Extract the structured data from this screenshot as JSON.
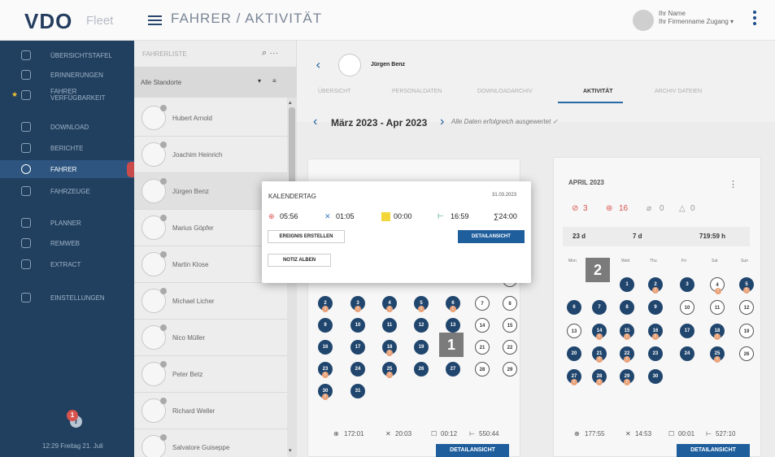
{
  "app": {
    "logo": "VDO",
    "logo_sub": "Fleet",
    "title": "FAHRER / AKTIVITÄT"
  },
  "user": {
    "name": "Ihr Name",
    "sub": "Ihr Firmenname Zugang"
  },
  "sidebar": {
    "items": [
      {
        "label": "ÜBERSICHTSTAFEL",
        "icon": "dashboard-icon"
      },
      {
        "label": "ERINNERUNGEN",
        "icon": "bell-icon"
      },
      {
        "label": "FAHRER VERFÜGBARKEIT",
        "icon": "availability-icon"
      },
      {
        "label": "DOWNLOAD",
        "icon": "download-icon"
      },
      {
        "label": "BERICHTE",
        "icon": "report-icon"
      },
      {
        "label": "FAHRER",
        "icon": "driver-icon"
      },
      {
        "label": "FAHRZEUGE",
        "icon": "truck-icon"
      },
      {
        "label": "PLANNER",
        "icon": "planner-icon"
      },
      {
        "label": "REMWEB",
        "icon": "remweb-icon"
      },
      {
        "label": "EXTRACT",
        "icon": "extract-icon"
      },
      {
        "label": "EINSTELLUNGEN",
        "icon": "settings-icon"
      }
    ],
    "time": "12:29 Freitag 21. Juli",
    "badge": "1"
  },
  "list": {
    "placeholder": "FAHRERLISTE",
    "location": "Alle Standorte",
    "drivers": [
      "Hubert Arnold",
      "Joachim Heinrich",
      "Jürgen Benz",
      "Marius Göpfer",
      "Martin Klose",
      "Michael Licher",
      "Nico Müller",
      "Peter Betz",
      "Richard Weller",
      "Salvatore Guiseppe"
    ]
  },
  "detail": {
    "driver": "Jürgen Benz",
    "tabs": [
      "ÜBERSICHT",
      "PERSONALDATEN",
      "DOWNLOADARCHIV",
      "AKTIVITÄT",
      "ARCHIV DATEIEN"
    ],
    "range": "März 2023 - Apr 2023",
    "status": "Alle Daten erfolgreich ausgewertet ✓"
  },
  "popup": {
    "title": "KALENDERTAG",
    "date": "31.03.2023",
    "drive": "05:56",
    "work": "01:05",
    "avail": "00:00",
    "rest": "16:59",
    "total": "∑24:00",
    "btn_event": "EREIGNIS ERSTELLEN",
    "btn_detail": "DETAILANSICHT",
    "btn_note": "NOTIZ ALBEN"
  },
  "march": {
    "days": [
      "1",
      "2",
      "3",
      "4",
      "5",
      "6",
      "7",
      "8",
      "9",
      "10",
      "11",
      "12",
      "13",
      "14",
      "15",
      "16",
      "17",
      "18",
      "19",
      "20",
      "21",
      "22",
      "23",
      "24",
      "25",
      "26",
      "27",
      "28",
      "29",
      "30",
      "31"
    ],
    "sum_drive": "172:01",
    "sum_work": "20:03",
    "sum_avail": "00:12",
    "sum_rest": "550:44",
    "btn": "DETAILANSICHT"
  },
  "april": {
    "title": "APRIL 2023",
    "c1": "3",
    "c2": "16",
    "c3": "0",
    "c4": "0",
    "days_count": "23 d",
    "days_x": "7 d",
    "total": "719:59 h",
    "weekdays": [
      "Mon",
      "Tue",
      "Wed",
      "Thu",
      "Fri",
      "Sat",
      "Sun"
    ],
    "sum_drive": "177:55",
    "sum_work": "14:53",
    "sum_avail": "00:01",
    "sum_rest": "527:10",
    "btn": "DETAILANSICHT"
  },
  "markers": {
    "m1": "1",
    "m2": "2"
  },
  "colors": {
    "sidebar": "#21405f",
    "accent": "#1f5e9c",
    "filled_day": "#21466e"
  }
}
